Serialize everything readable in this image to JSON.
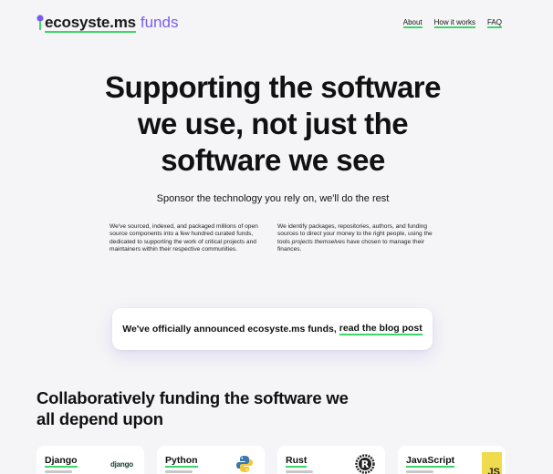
{
  "header": {
    "logo_text": "ecosyste.ms",
    "logo_suffix": "funds",
    "nav": [
      "About",
      "How it works",
      "FAQ"
    ]
  },
  "hero": {
    "title": "Supporting the software we use, not just the software we see",
    "subtitle": "Sponsor the technology you rely on, we'll do the rest",
    "left_text": "We've sourced, indexed, and packaged millions of open source components into a few hundred curated funds, dedicated to supporting the work of critical projects and maintainers within their respective communities.",
    "right_text_before": "We identify packages, repositories, authors, and funding sources to direct your money to the right people, using the tools ",
    "right_text_em": "projects themselves",
    "right_text_after": " have chosen to manage their finances."
  },
  "announcement": {
    "text": "We've officially announced ecosyste.ms funds,",
    "link": "read the blog post"
  },
  "section": {
    "title": "Collaboratively funding the software we all depend upon"
  },
  "funds": [
    {
      "name": "Django",
      "logo": "django-logo",
      "logo_text": "django"
    },
    {
      "name": "Python",
      "logo": "python-logo"
    },
    {
      "name": "Rust",
      "logo": "rust-logo"
    },
    {
      "name": "JavaScript",
      "logo": "javascript-logo",
      "logo_text": "JS"
    }
  ],
  "colors": {
    "accent_green": "#3dd66b",
    "brand_purple": "#7b5cf0",
    "background": "#f5f5f7"
  }
}
